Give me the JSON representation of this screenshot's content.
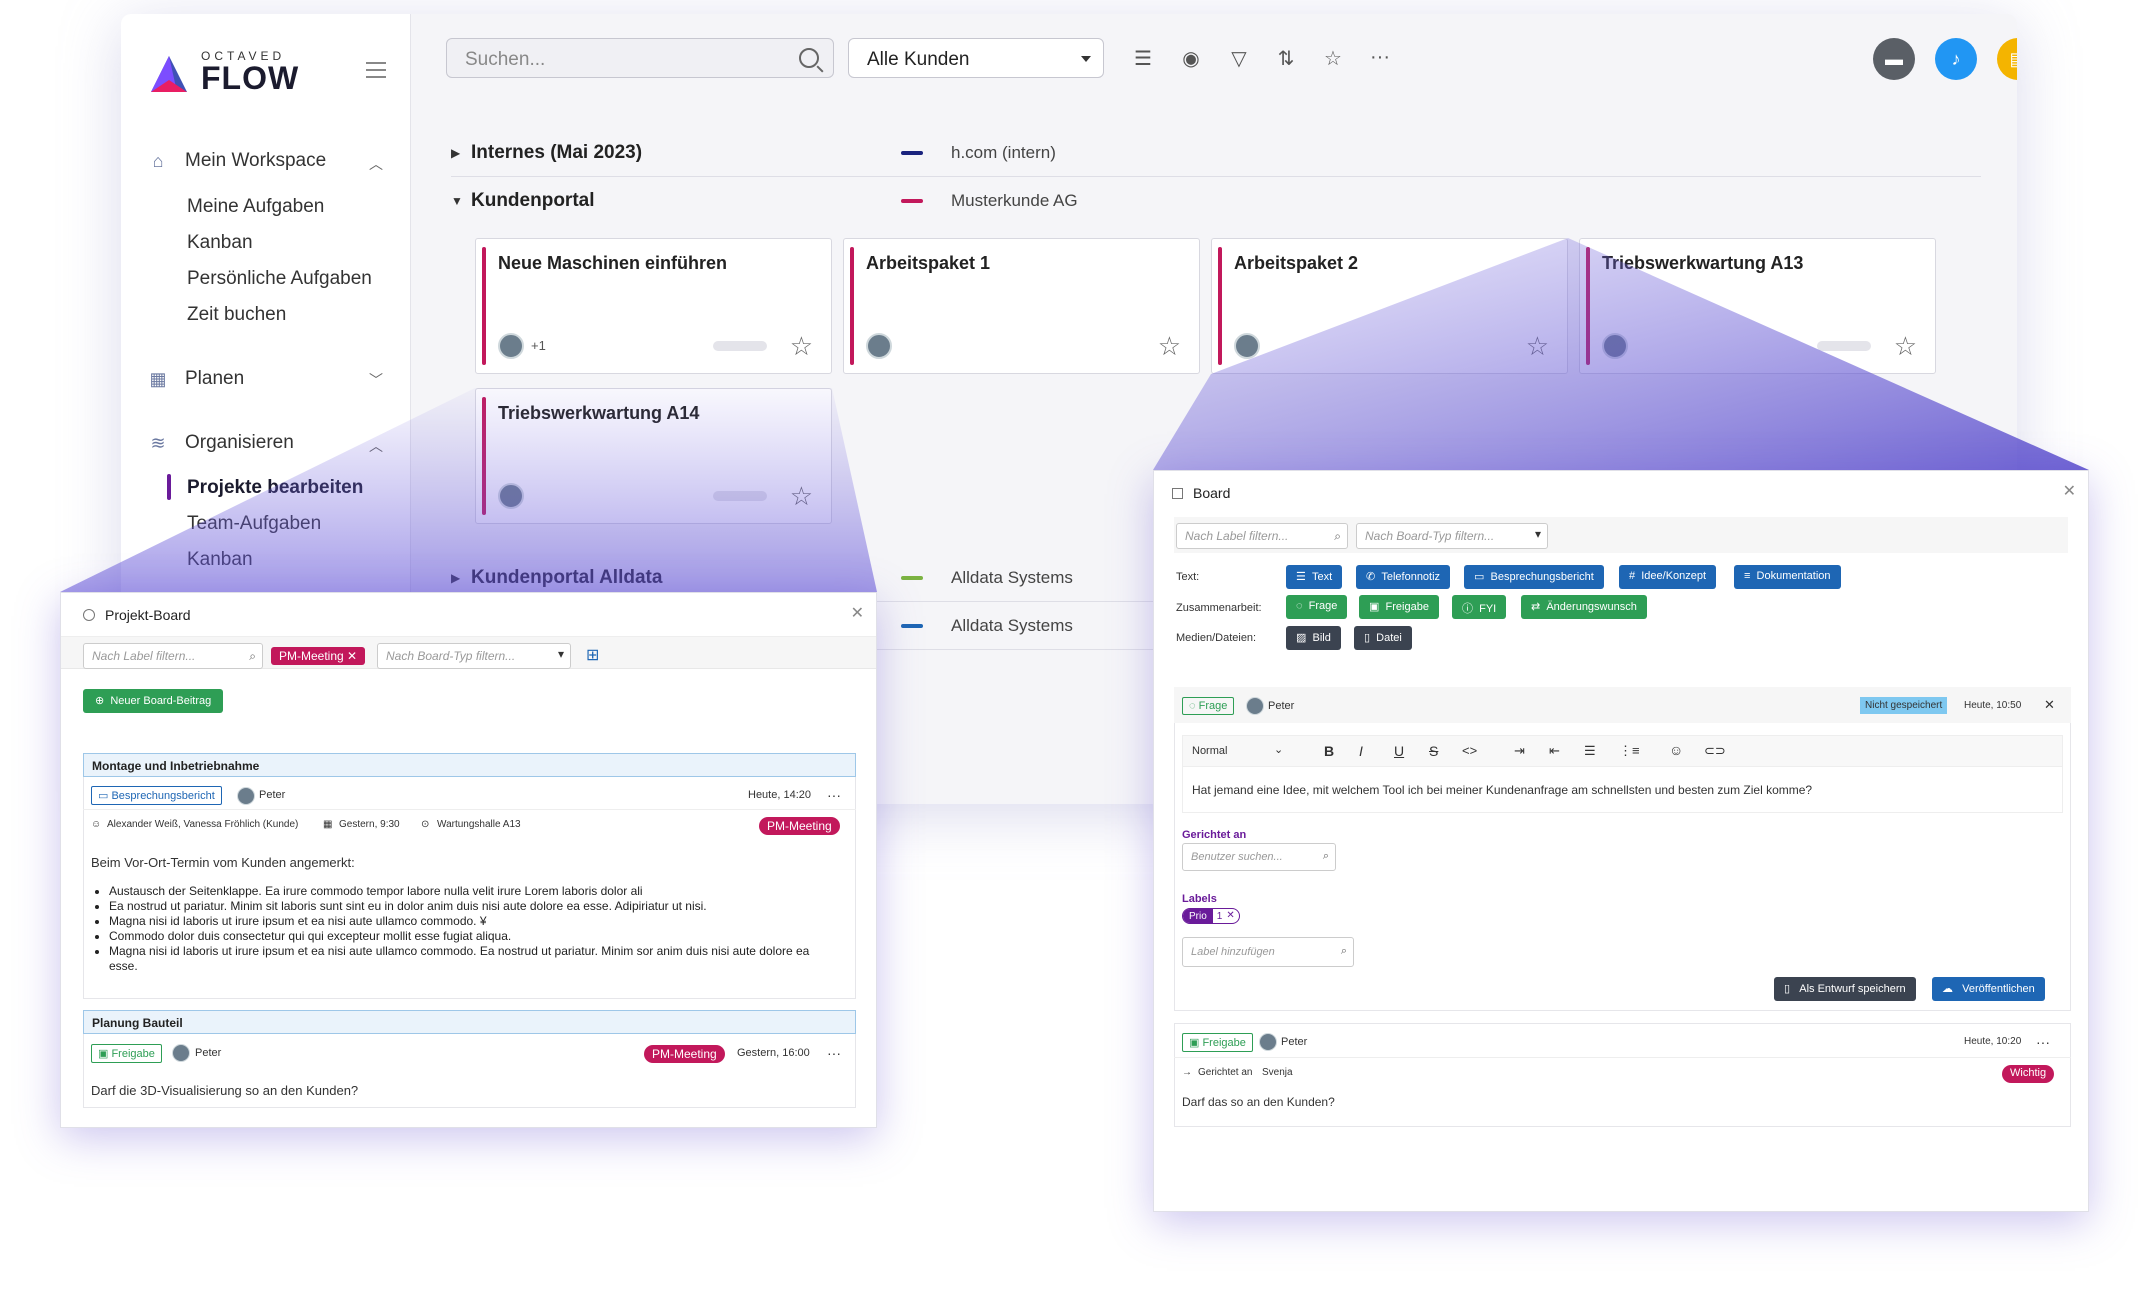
{
  "sidebar": {
    "logo_small": "OCTAVED",
    "logo_big": "FLOW",
    "groups": [
      {
        "label": "Mein Workspace"
      },
      {
        "label": "Planen"
      },
      {
        "label": "Organisieren"
      }
    ],
    "workspace_items": [
      "Meine Aufgaben",
      "Kanban",
      "Persönliche Aufgaben",
      "Zeit buchen"
    ],
    "organize_items": [
      "Projekte bearbeiten",
      "Team-Aufgaben",
      "Kanban"
    ]
  },
  "topbar": {
    "search_placeholder": "Suchen...",
    "customer_select": "Alle Kunden"
  },
  "colors": {
    "accent": "#6a1b9a",
    "magenta": "#c2185b",
    "blue": "#1e66b4",
    "green": "#2e9e55"
  },
  "projects": [
    {
      "name": "Internes (Mai 2023)",
      "customer": "h.com (intern)",
      "color": "#1a237e"
    },
    {
      "name": "Kundenportal",
      "customer": "Musterkunde AG",
      "color": "#c2185b"
    },
    {
      "name": "Kundenportal Alldata",
      "customer": "Alldata Systems",
      "color": "#7cb342"
    },
    {
      "name": "",
      "customer": "Alldata Systems",
      "color": "#1e66b4"
    }
  ],
  "cards": [
    {
      "title": "Neue Maschinen einführen",
      "extra": "+1"
    },
    {
      "title": "Arbeitspaket 1"
    },
    {
      "title": "Arbeitspaket 2"
    },
    {
      "title": "Triebswerkwartung A13"
    },
    {
      "title": "Triebswerkwartung A14"
    }
  ],
  "left_panel": {
    "title": "Projekt-Board",
    "label_filter": "Nach Label filtern...",
    "type_filter": "Nach Board-Typ filtern...",
    "active_tag": "PM-Meeting",
    "new_button": "Neuer Board-Beitrag",
    "post1": {
      "section": "Montage und Inbetriebnahme",
      "type": "Besprechungsbericht",
      "author": "Peter",
      "time": "Heute, 14:20",
      "participants": "Alexander Weiß, Vanessa Fröhlich (Kunde)",
      "date": "Gestern, 9:30",
      "location": "Wartungshalle A13",
      "tag": "PM-Meeting",
      "intro": "Beim Vor-Ort-Termin vom Kunden angemerkt:",
      "bullets": [
        "Austausch der Seitenklappe. Ea irure commodo tempor labore nulla velit irure Lorem laboris dolor ali",
        "Ea nostrud ut pariatur. Minim sit laboris sunt sint eu in dolor anim duis nisi aute dolore ea esse. Adipiriatur ut nisi.",
        "Magna nisi id laboris ut irure ipsum et ea nisi aute ullamco commodo. ¥",
        "Commodo dolor duis consectetur qui qui excepteur mollit esse fugiat aliqua.",
        "Magna nisi id laboris ut irure ipsum et ea nisi aute ullamco commodo. Ea nostrud ut pariatur. Minim sor anim duis nisi aute dolore ea esse."
      ]
    },
    "post2": {
      "section": "Planung Bauteil",
      "type": "Freigabe",
      "author": "Peter",
      "tag": "PM-Meeting",
      "time": "Gestern, 16:00",
      "text": "Darf die 3D-Visualisierung so an den Kunden?"
    }
  },
  "right_panel": {
    "title": "Board",
    "label_filter": "Nach Label filtern...",
    "type_filter": "Nach Board-Typ filtern...",
    "text_label": "Text:",
    "collab_label": "Zusammenarbeit:",
    "media_label": "Medien/Dateien:",
    "text_chips": [
      "Text",
      "Telefonnotiz",
      "Besprechungsbericht",
      "Idee/Konzept",
      "Dokumentation"
    ],
    "collab_chips": [
      "Frage",
      "Freigabe",
      "FYI",
      "Änderungswunsch"
    ],
    "media_chips": [
      "Bild",
      "Datei"
    ],
    "draft": {
      "type": "Frage",
      "author": "Peter",
      "status": "Nicht gespeichert",
      "time": "Heute, 10:50",
      "format": "Normal",
      "text": "Hat jemand eine Idee, mit welchem Tool ich bei meiner Kundenanfrage am schnellsten und besten zum Ziel komme?",
      "directed_label": "Gerichtet an",
      "user_placeholder": "Benutzer suchen...",
      "labels_label": "Labels",
      "label_chip": "Prio",
      "label_count": "1",
      "label_placeholder": "Label hinzufügen",
      "save_draft": "Als Entwurf speichern",
      "publish": "Veröffentlichen"
    },
    "post": {
      "type": "Freigabe",
      "author": "Peter",
      "time": "Heute, 10:20",
      "directed": "Gerichtet an",
      "target": "Svenja",
      "tag": "Wichtig",
      "text": "Darf das so an den Kunden?"
    }
  }
}
